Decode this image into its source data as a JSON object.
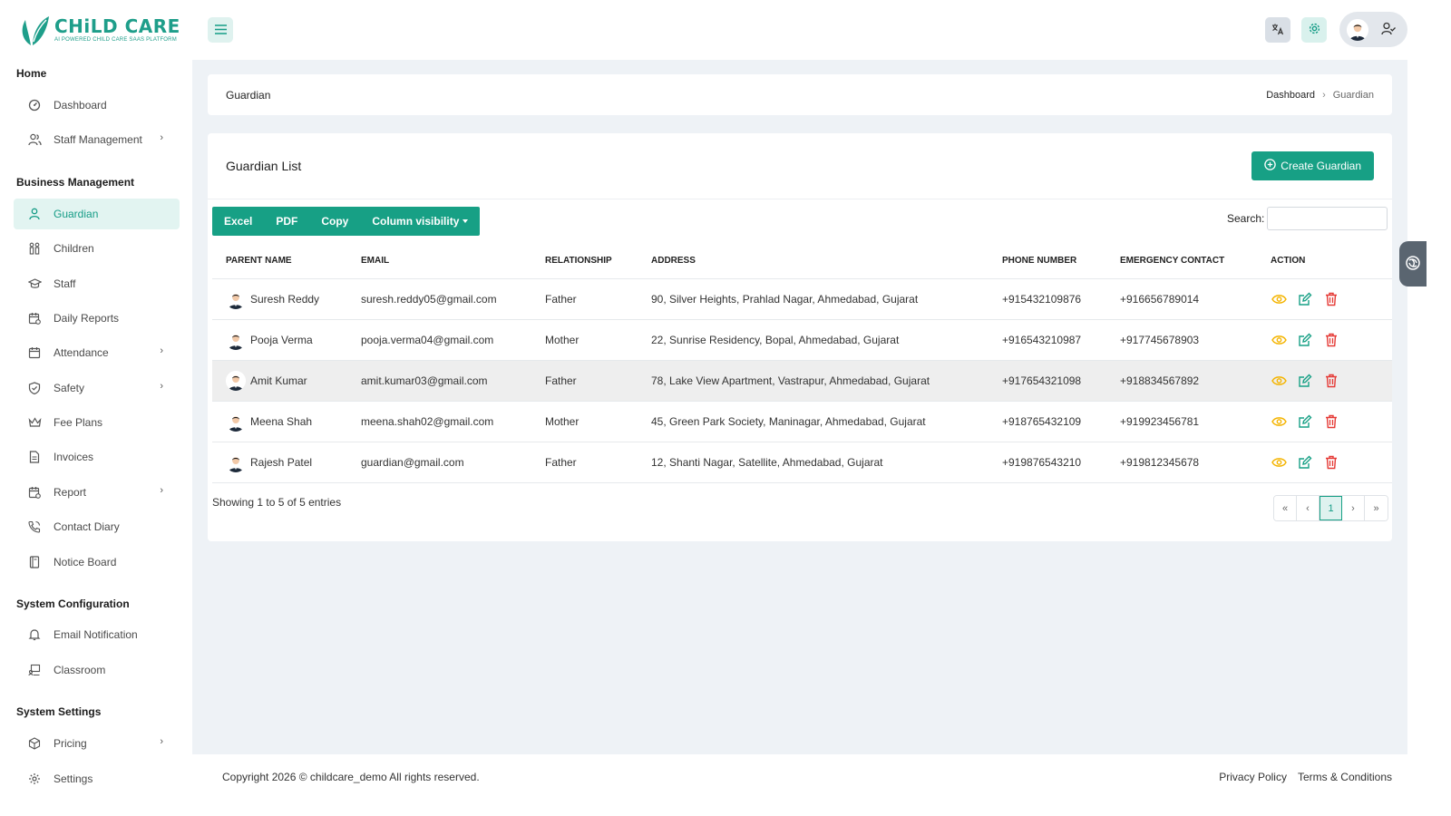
{
  "brand": {
    "title": "CHiLD CARE",
    "subtitle": "AI POWERED CHILD CARE SAAS PLATFORM",
    "accent": "#17a085"
  },
  "sidebar": {
    "sections": [
      {
        "title": "Home",
        "items": [
          {
            "label": "Dashboard",
            "icon": "gauge-icon"
          },
          {
            "label": "Staff Management",
            "icon": "users-icon",
            "chevron": true
          }
        ]
      },
      {
        "title": "Business Management",
        "items": [
          {
            "label": "Guardian",
            "icon": "user-icon",
            "active": true
          },
          {
            "label": "Children",
            "icon": "children-icon"
          },
          {
            "label": "Staff",
            "icon": "graduation-cap-icon"
          },
          {
            "label": "Daily Reports",
            "icon": "calendar-report-icon"
          },
          {
            "label": "Attendance",
            "icon": "calendar-icon",
            "chevron": true
          },
          {
            "label": "Safety",
            "icon": "shield-icon",
            "chevron": true
          },
          {
            "label": "Fee Plans",
            "icon": "crown-icon"
          },
          {
            "label": "Invoices",
            "icon": "document-icon"
          },
          {
            "label": "Report",
            "icon": "calendar-report-icon",
            "chevron": true
          },
          {
            "label": "Contact Diary",
            "icon": "phone-icon"
          },
          {
            "label": "Notice Board",
            "icon": "book-icon"
          }
        ]
      },
      {
        "title": "System Configuration",
        "items": [
          {
            "label": "Email Notification",
            "icon": "bell-icon"
          },
          {
            "label": "Classroom",
            "icon": "classroom-icon"
          }
        ]
      },
      {
        "title": "System Settings",
        "items": [
          {
            "label": "Pricing",
            "icon": "box-icon",
            "chevron": true
          },
          {
            "label": "Settings",
            "icon": "gear-icon"
          }
        ]
      }
    ]
  },
  "header": {
    "page_title": "Guardian",
    "breadcrumb": {
      "home": "Dashboard",
      "current": "Guardian"
    }
  },
  "card": {
    "title": "Guardian List",
    "create_label": "Create Guardian",
    "export_buttons": [
      "Excel",
      "PDF",
      "Copy",
      "Column visibility"
    ],
    "search_label": "Search:",
    "search_value": ""
  },
  "table": {
    "columns": [
      "PARENT NAME",
      "EMAIL",
      "RELATIONSHIP",
      "ADDRESS",
      "PHONE NUMBER",
      "EMERGENCY CONTACT",
      "ACTION"
    ],
    "rows": [
      {
        "name": "Suresh Reddy",
        "email": "suresh.reddy05@gmail.com",
        "relationship": "Father",
        "address": "90, Silver Heights, Prahlad Nagar, Ahmedabad, Gujarat",
        "phone": "+915432109876",
        "emergency": "+916656789014"
      },
      {
        "name": "Pooja Verma",
        "email": "pooja.verma04@gmail.com",
        "relationship": "Mother",
        "address": "22, Sunrise Residency, Bopal, Ahmedabad, Gujarat",
        "phone": "+916543210987",
        "emergency": "+917745678903"
      },
      {
        "name": "Amit Kumar",
        "email": "amit.kumar03@gmail.com",
        "relationship": "Father",
        "address": "78, Lake View Apartment, Vastrapur, Ahmedabad, Gujarat",
        "phone": "+917654321098",
        "emergency": "+918834567892"
      },
      {
        "name": "Meena Shah",
        "email": "meena.shah02@gmail.com",
        "relationship": "Mother",
        "address": "45, Green Park Society, Maninagar, Ahmedabad, Gujarat",
        "phone": "+918765432109",
        "emergency": "+919923456781"
      },
      {
        "name": "Rajesh Patel",
        "email": "guardian@gmail.com",
        "relationship": "Father",
        "address": "12, Shanti Nagar, Satellite, Ahmedabad, Gujarat",
        "phone": "+919876543210",
        "emergency": "+919812345678"
      }
    ]
  },
  "pagination": {
    "summary": "Showing 1 to 5 of 5 entries",
    "first": "«",
    "prev": "‹",
    "current": "1",
    "next": "›",
    "last": "»"
  },
  "footer": {
    "copyright": "Copyright 2026 © childcare_demo All rights reserved.",
    "links": [
      "Privacy Policy",
      "Terms & Conditions"
    ]
  }
}
